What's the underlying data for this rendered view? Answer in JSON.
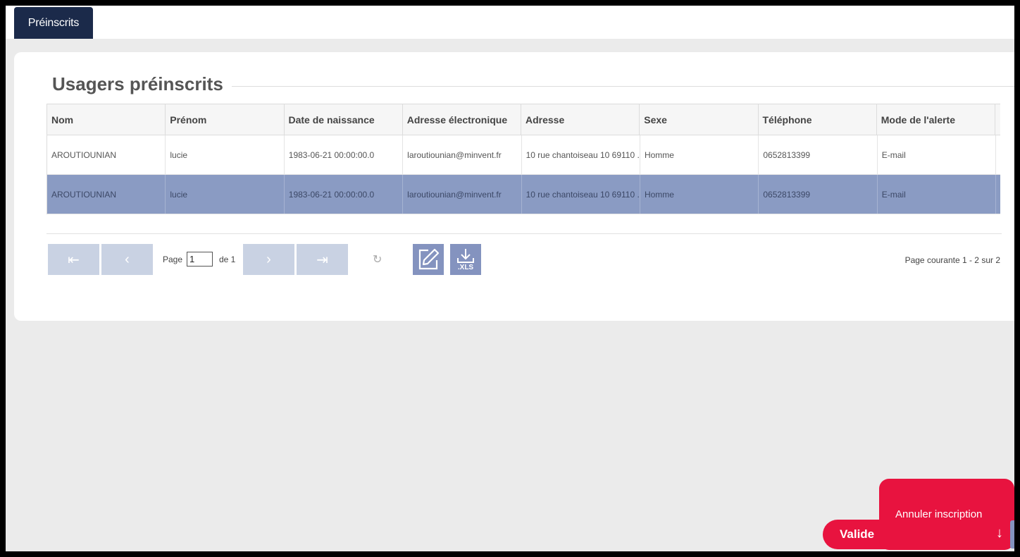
{
  "tabs": {
    "preinscrits": "Préinscrits"
  },
  "panel": {
    "title": "Usagers préinscrits"
  },
  "table": {
    "columns": [
      "Nom",
      "Prénom",
      "Date de naissance",
      "Adresse électronique",
      "Adresse",
      "Sexe",
      "Téléphone",
      "Mode de l'alerte"
    ],
    "rows": [
      [
        "AROUTIOUNIAN",
        "lucie",
        "1983-06-21 00:00:00.0",
        "laroutiounian@minvent.fr",
        "10 rue chantoiseau 10 69110 ...",
        "Homme",
        "0652813399",
        "E-mail"
      ],
      [
        "AROUTIOUNIAN",
        "lucie",
        "1983-06-21 00:00:00.0",
        "laroutiounian@minvent.fr",
        "10 rue chantoiseau 10 69110 ...",
        "Homme",
        "0652813399",
        "E-mail"
      ]
    ],
    "selected_row": 1
  },
  "pager": {
    "page_label": "Page",
    "page_value": "1",
    "of_label": "de 1",
    "info": "Page courante 1 - 2 sur 2",
    "first": "⇤",
    "prev": "‹",
    "next": "›",
    "last": "⇥",
    "refresh": "↻",
    "xls_label": ".XLS"
  },
  "actions": {
    "valider": "Valide",
    "annuler": "Annuler inscription",
    "down_arrow": "↓"
  },
  "colors": {
    "accent_red": "#e8133f",
    "navy": "#1b2a4a",
    "selected_row": "#8a9bc3",
    "pager_btn": "#c9d2e3"
  }
}
